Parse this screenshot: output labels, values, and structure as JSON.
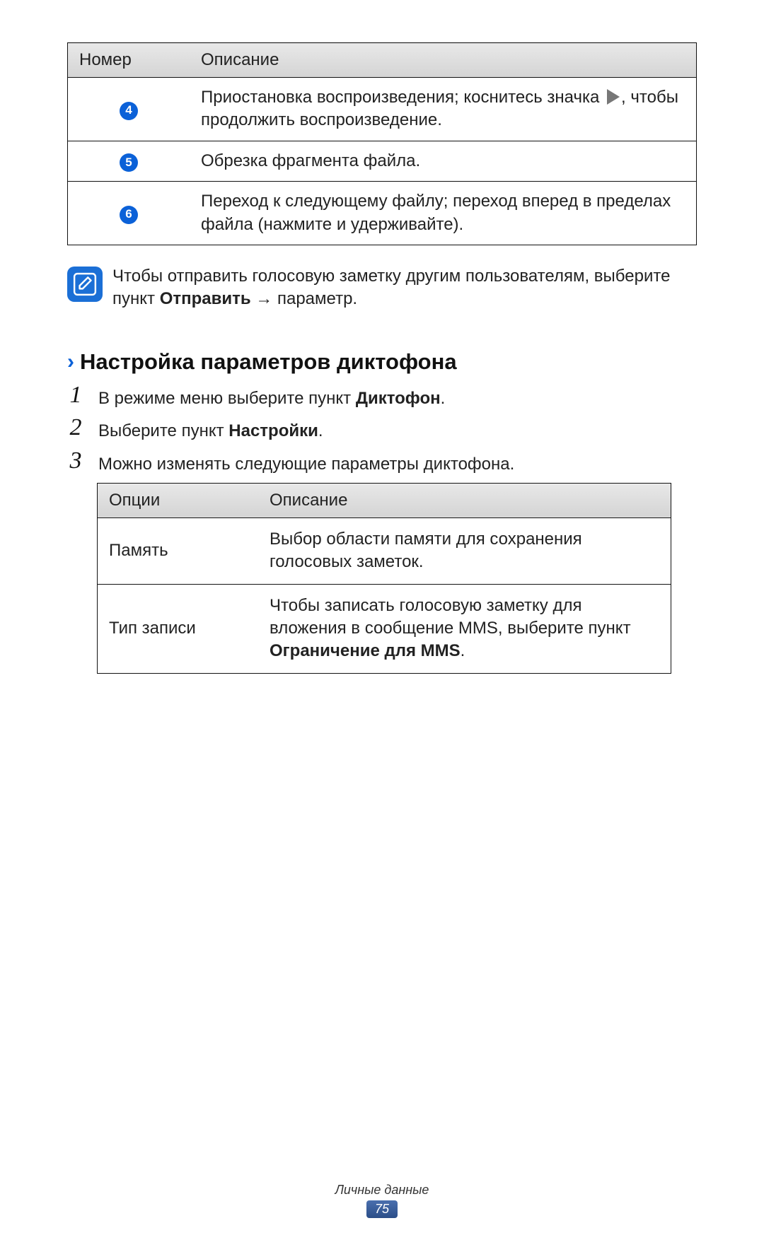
{
  "table1": {
    "header_number": "Номер",
    "header_description": "Описание",
    "rows": [
      {
        "num": "4",
        "desc_pre": "Приостановка воспроизведения; коснитесь значка ",
        "desc_post": ", чтобы продолжить воспроизведение."
      },
      {
        "num": "5",
        "desc": "Обрезка фрагмента файла."
      },
      {
        "num": "6",
        "desc": "Переход к следующему файлу; переход вперед в пределах файла (нажмите и удерживайте)."
      }
    ]
  },
  "note": {
    "text_pre": "Чтобы отправить голосовую заметку другим пользователям, выберите пункт ",
    "bold": "Отправить",
    "arrow": " → ",
    "text_post": "параметр."
  },
  "heading": "Настройка параметров диктофона",
  "steps": [
    {
      "num": "1",
      "pre": "В режиме меню выберите пункт ",
      "bold": "Диктофон",
      "post": "."
    },
    {
      "num": "2",
      "pre": "Выберите пункт ",
      "bold": "Настройки",
      "post": "."
    },
    {
      "num": "3",
      "pre": "Можно изменять следующие параметры диктофона.",
      "bold": "",
      "post": ""
    }
  ],
  "table2": {
    "header_option": "Опции",
    "header_description": "Описание",
    "rows": [
      {
        "opt": "Память",
        "desc": "Выбор области памяти для сохранения голосовых заметок."
      },
      {
        "opt": "Тип записи",
        "desc_pre": "Чтобы записать голосовую заметку для вложения в сообщение MMS, выберите пункт ",
        "bold": "Ограничение для MMS",
        "desc_post": "."
      }
    ]
  },
  "footer": {
    "section": "Личные данные",
    "page": "75"
  }
}
